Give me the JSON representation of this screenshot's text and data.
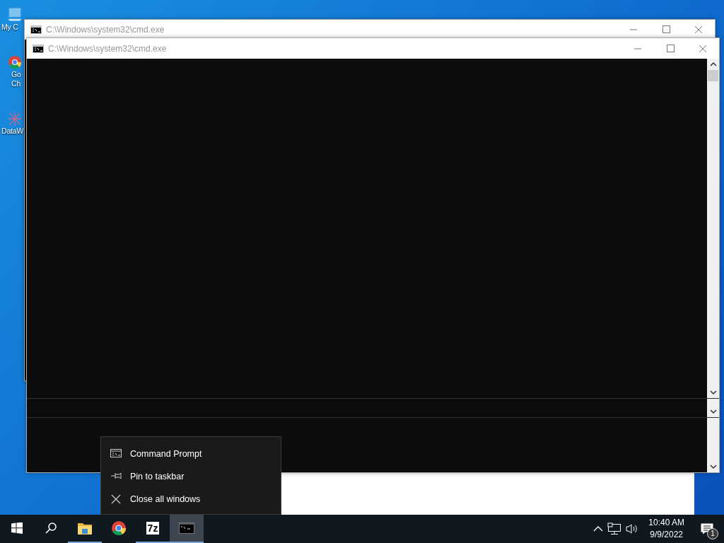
{
  "desktop_icons": [
    {
      "kind": "computer",
      "lines": [
        "My C"
      ]
    },
    {
      "kind": "chrome",
      "lines": [
        "Go",
        "Ch"
      ]
    },
    {
      "kind": "dataw",
      "lines": [
        "DataW"
      ]
    }
  ],
  "windows": [
    {
      "title": "C:\\Windows\\system32\\cmd.exe",
      "kind": "back"
    },
    {
      "title": "C:\\Windows\\system32\\cmd.exe",
      "kind": "front"
    }
  ],
  "context_menu": {
    "items": [
      {
        "kind": "app",
        "label": "Command Prompt"
      },
      {
        "kind": "pin",
        "label": "Pin to taskbar"
      },
      {
        "kind": "close",
        "label": "Close all windows"
      }
    ]
  },
  "taskbar": {
    "items": [
      {
        "kind": "start",
        "running": false,
        "selected": false
      },
      {
        "kind": "search",
        "running": false,
        "selected": false
      },
      {
        "kind": "explorer",
        "running": true,
        "selected": false
      },
      {
        "kind": "chrome",
        "running": false,
        "selected": false
      },
      {
        "kind": "sevenzip",
        "label": "7z",
        "running": true,
        "selected": false
      },
      {
        "kind": "cmd",
        "running": true,
        "selected": true
      }
    ],
    "clock": {
      "time": "10:40 AM",
      "date": "9/9/2022"
    },
    "notification_count": "1"
  }
}
